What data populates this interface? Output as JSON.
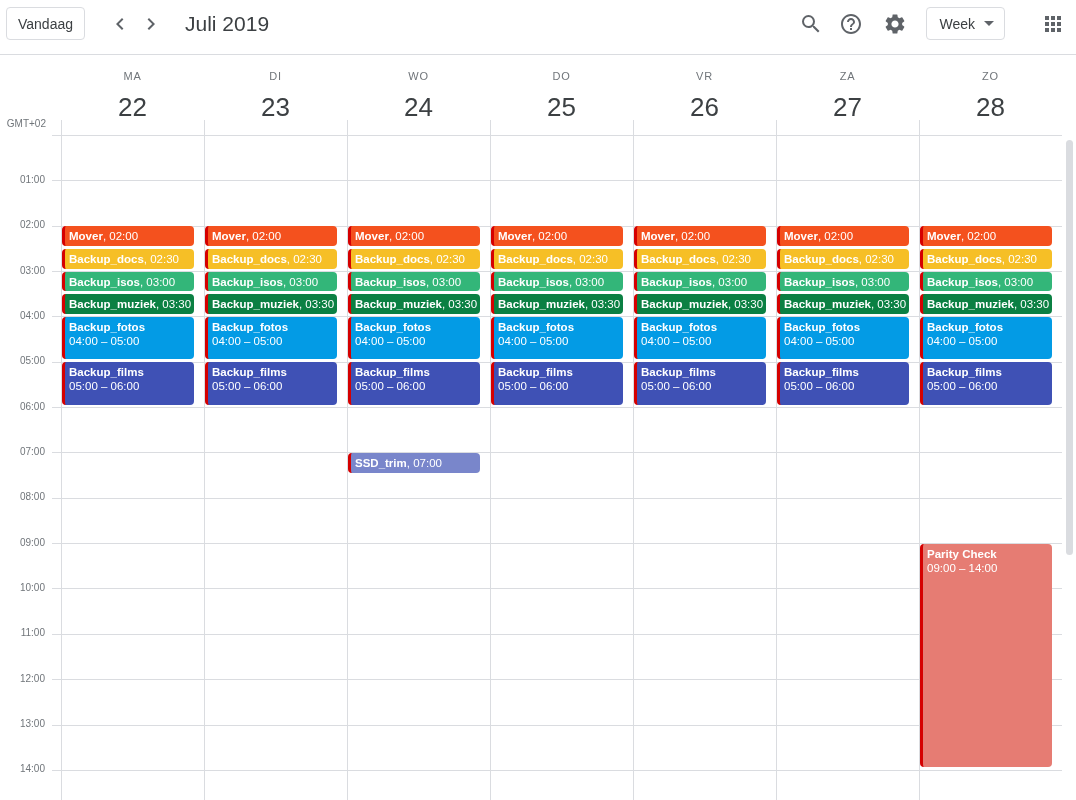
{
  "toolbar": {
    "today_button": "Vandaag",
    "title": "Juli 2019",
    "view_button": "Week"
  },
  "timezone": "GMT+02",
  "hours": [
    "01:00",
    "02:00",
    "03:00",
    "04:00",
    "05:00",
    "06:00",
    "07:00",
    "08:00",
    "09:00",
    "10:00",
    "11:00",
    "12:00",
    "13:00",
    "14:00"
  ],
  "days": [
    {
      "weekday": "MA",
      "date": "22",
      "events": [
        {
          "kind": "short",
          "label": "**Mover**, 02:00",
          "color": "#f4511e"
        },
        {
          "kind": "short",
          "label": "**Backup_docs**, 02:30",
          "color": "#f6bf26"
        },
        {
          "kind": "short",
          "label": "**Backup_isos**, 03:00",
          "color": "#33b679"
        },
        {
          "kind": "short",
          "label": "**Backup_muziek**, 03:30",
          "color": "#0b8043"
        },
        {
          "kind": "long",
          "title": "Backup_fotos",
          "time": "04:00 – 05:00",
          "color": "#039be5"
        },
        {
          "kind": "long",
          "title": "Backup_films",
          "time": "05:00 – 06:00",
          "color": "#3f51b5"
        }
      ]
    },
    {
      "weekday": "DI",
      "date": "23",
      "events": [
        {
          "kind": "short",
          "label": "**Mover**, 02:00",
          "color": "#f4511e"
        },
        {
          "kind": "short",
          "label": "**Backup_docs**, 02:30",
          "color": "#f6bf26"
        },
        {
          "kind": "short",
          "label": "**Backup_isos**, 03:00",
          "color": "#33b679"
        },
        {
          "kind": "short",
          "label": "**Backup_muziek**, 03:30",
          "color": "#0b8043"
        },
        {
          "kind": "long",
          "title": "Backup_fotos",
          "time": "04:00 – 05:00",
          "color": "#039be5"
        },
        {
          "kind": "long",
          "title": "Backup_films",
          "time": "05:00 – 06:00",
          "color": "#3f51b5"
        }
      ]
    },
    {
      "weekday": "WO",
      "date": "24",
      "events": [
        {
          "kind": "short",
          "label": "**Mover**, 02:00",
          "color": "#f4511e"
        },
        {
          "kind": "short",
          "label": "**Backup_docs**, 02:30",
          "color": "#f6bf26"
        },
        {
          "kind": "short",
          "label": "**Backup_isos**, 03:00",
          "color": "#33b679"
        },
        {
          "kind": "short",
          "label": "**Backup_muziek**, 03:30",
          "color": "#0b8043"
        },
        {
          "kind": "long",
          "title": "Backup_fotos",
          "time": "04:00 – 05:00",
          "color": "#039be5"
        },
        {
          "kind": "long",
          "title": "Backup_films",
          "time": "05:00 – 06:00",
          "color": "#3f51b5"
        },
        {
          "kind": "short",
          "label": "**SSD_trim**, 07:00",
          "color": "#7986cb"
        }
      ]
    },
    {
      "weekday": "DO",
      "date": "25",
      "events": [
        {
          "kind": "short",
          "label": "**Mover**, 02:00",
          "color": "#f4511e"
        },
        {
          "kind": "short",
          "label": "**Backup_docs**, 02:30",
          "color": "#f6bf26"
        },
        {
          "kind": "short",
          "label": "**Backup_isos**, 03:00",
          "color": "#33b679"
        },
        {
          "kind": "short",
          "label": "**Backup_muziek**, 03:30",
          "color": "#0b8043"
        },
        {
          "kind": "long",
          "title": "Backup_fotos",
          "time": "04:00 – 05:00",
          "color": "#039be5"
        },
        {
          "kind": "long",
          "title": "Backup_films",
          "time": "05:00 – 06:00",
          "color": "#3f51b5"
        }
      ]
    },
    {
      "weekday": "VR",
      "date": "26",
      "events": [
        {
          "kind": "short",
          "label": "**Mover**, 02:00",
          "color": "#f4511e"
        },
        {
          "kind": "short",
          "label": "**Backup_docs**, 02:30",
          "color": "#f6bf26"
        },
        {
          "kind": "short",
          "label": "**Backup_isos**, 03:00",
          "color": "#33b679"
        },
        {
          "kind": "short",
          "label": "**Backup_muziek**, 03:30",
          "color": "#0b8043"
        },
        {
          "kind": "long",
          "title": "Backup_fotos",
          "time": "04:00 – 05:00",
          "color": "#039be5"
        },
        {
          "kind": "long",
          "title": "Backup_films",
          "time": "05:00 – 06:00",
          "color": "#3f51b5"
        }
      ]
    },
    {
      "weekday": "ZA",
      "date": "27",
      "events": [
        {
          "kind": "short",
          "label": "**Mover**, 02:00",
          "color": "#f4511e"
        },
        {
          "kind": "short",
          "label": "**Backup_docs**, 02:30",
          "color": "#f6bf26"
        },
        {
          "kind": "short",
          "label": "**Backup_isos**, 03:00",
          "color": "#33b679"
        },
        {
          "kind": "short",
          "label": "**Backup_muziek**, 03:30",
          "color": "#0b8043"
        },
        {
          "kind": "long",
          "title": "Backup_fotos",
          "time": "04:00 – 05:00",
          "color": "#039be5"
        },
        {
          "kind": "long",
          "title": "Backup_films",
          "time": "05:00 – 06:00",
          "color": "#3f51b5"
        }
      ]
    },
    {
      "weekday": "ZO",
      "date": "28",
      "events": [
        {
          "kind": "short",
          "label": "**Mover**, 02:00",
          "color": "#f4511e"
        },
        {
          "kind": "short",
          "label": "**Backup_docs**, 02:30",
          "color": "#f6bf26"
        },
        {
          "kind": "short",
          "label": "**Backup_isos**, 03:00",
          "color": "#33b679"
        },
        {
          "kind": "short",
          "label": "**Backup_muziek**, 03:30",
          "color": "#0b8043"
        },
        {
          "kind": "long",
          "title": "Backup_fotos",
          "time": "04:00 – 05:00",
          "color": "#039be5"
        },
        {
          "kind": "long",
          "title": "Backup_films",
          "time": "05:00 – 06:00",
          "color": "#3f51b5"
        },
        {
          "kind": "long",
          "title": "Parity Check",
          "time": "09:00 – 14:00",
          "color": "#e67c73"
        }
      ]
    }
  ]
}
